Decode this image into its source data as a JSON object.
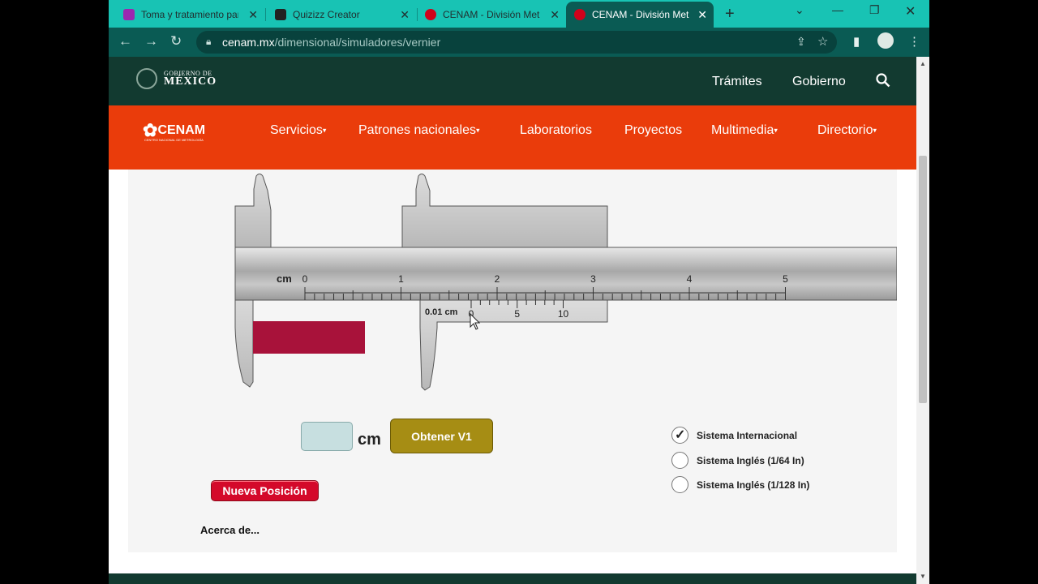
{
  "browser": {
    "tabs": [
      {
        "title": "Toma y tratamiento par",
        "favicon_color": "#9c27b0",
        "active": false
      },
      {
        "title": "Quizizz Creator",
        "favicon_color": "#222222",
        "active": false
      },
      {
        "title": "CENAM - División Metr",
        "favicon_color": "#d0021b",
        "active": false
      },
      {
        "title": "CENAM - División Metr",
        "favicon_color": "#d0021b",
        "active": true
      }
    ],
    "url_domain": "cenam.mx",
    "url_path": "/dimensional/simuladores/vernier",
    "accent": "#18c3b4"
  },
  "gov_header": {
    "logo_line1": "GOBIERNO DE",
    "logo_line2": "MÉXICO",
    "links": [
      "Trámites",
      "Gobierno"
    ],
    "bg_color": "#123a30"
  },
  "cenam_nav": {
    "logo_text": "CENAM",
    "logo_subtext": "CENTRO NACIONAL DE METROLOGÍA",
    "items": [
      {
        "label": "Servicios",
        "dropdown": true
      },
      {
        "label": "Patrones nacionales",
        "dropdown": true
      },
      {
        "label": "Laboratorios",
        "dropdown": false
      },
      {
        "label": "Proyectos",
        "dropdown": false
      },
      {
        "label": "Multimedia",
        "dropdown": true
      },
      {
        "label": "Directorio",
        "dropdown": true
      }
    ],
    "bg_color": "#ea3c0b"
  },
  "simulator": {
    "main_scale_unit": "cm",
    "main_scale_numbers": [
      "0",
      "1",
      "2",
      "3",
      "4",
      "5"
    ],
    "vernier_resolution": "0.01 cm",
    "vernier_numbers": [
      "0",
      "5",
      "10"
    ],
    "unit_label": "cm",
    "input_value": "",
    "get_button": "Obtener V1",
    "new_position_button": "Nueva Posición",
    "about_link": "Acerca de...",
    "object_color": "#a8123a",
    "options": [
      {
        "label": "Sistema Internacional",
        "checked": true
      },
      {
        "label": "Sistema Inglés (1/64 In)",
        "checked": false
      },
      {
        "label": "Sistema Inglés (1/128 In)",
        "checked": false
      }
    ]
  }
}
